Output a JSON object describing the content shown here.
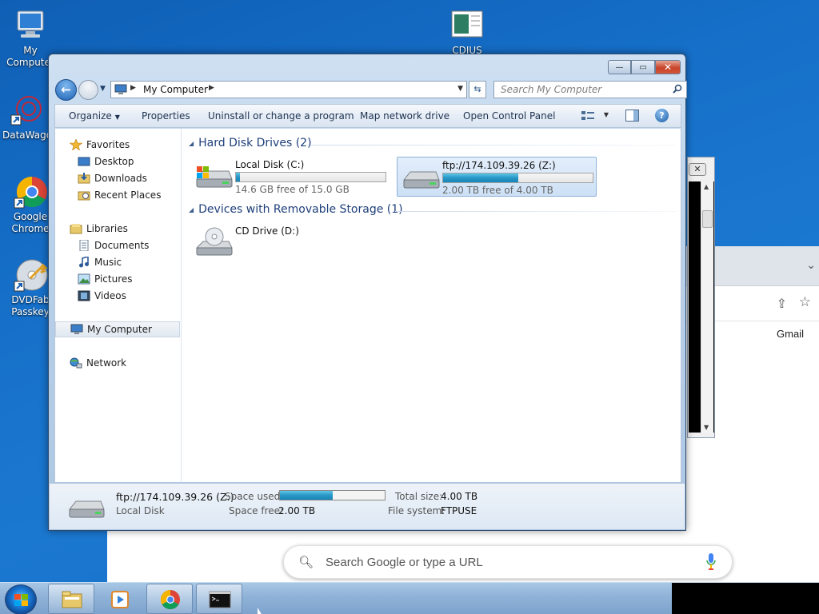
{
  "desktop": {
    "icons": [
      {
        "label": "My Computer"
      },
      {
        "label": "CDIUS"
      },
      {
        "label": "DataWago"
      },
      {
        "label": "Google Chrome"
      },
      {
        "label": "DVDFab Passkey"
      }
    ]
  },
  "browser": {
    "gmail": "Gmail",
    "search_placeholder": "Search Google or type a URL"
  },
  "explorer": {
    "address": {
      "location": "My Computer"
    },
    "search_placeholder": "Search My Computer",
    "window_buttons": {
      "minimize": "—",
      "maximize": "▭",
      "close": "✕"
    },
    "toolbar": {
      "organize": "Organize",
      "properties": "Properties",
      "uninstall": "Uninstall or change a program",
      "map_drive": "Map network drive",
      "control_panel": "Open Control Panel"
    },
    "nav": {
      "favorites": "Favorites",
      "desktop": "Desktop",
      "downloads": "Downloads",
      "recent": "Recent Places",
      "libraries": "Libraries",
      "documents": "Documents",
      "music": "Music",
      "pictures": "Pictures",
      "videos": "Videos",
      "computer": "My Computer",
      "network": "Network"
    },
    "groups": {
      "hdd": "Hard Disk Drives (2)",
      "removable": "Devices with Removable Storage (1)"
    },
    "drives": [
      {
        "name": "Local Disk (C:)",
        "free": "14.6 GB free of 15.0 GB",
        "used_fraction": 0.027
      },
      {
        "name": "ftp://174.109.39.26 (Z:)",
        "free": "2.00 TB free of 4.00 TB",
        "used_fraction": 0.5
      }
    ],
    "cd": {
      "name": "CD Drive (D:)"
    },
    "details": {
      "name": "ftp://174.109.39.26 (Z:)",
      "type": "Local Disk",
      "space_used_label": "Space used:",
      "space_free_label": "Space free:",
      "space_free": "2.00 TB",
      "total_label": "Total size:",
      "total": "4.00 TB",
      "fs_label": "File system:",
      "fs": "FTPUSE",
      "used_fraction": 0.5
    }
  },
  "colors": {
    "desktop": "#1670c9",
    "accent": "#2897c7",
    "close": "#c8452a"
  }
}
